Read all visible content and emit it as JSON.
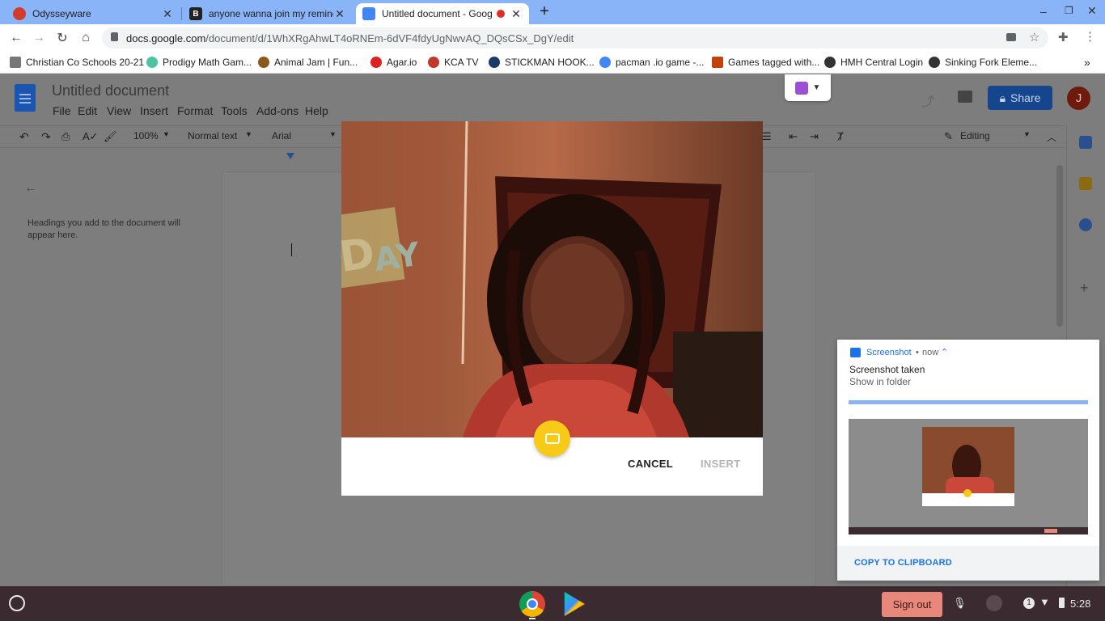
{
  "tabs": [
    {
      "title": "Odysseyware",
      "favicon_color": "#d23c2b"
    },
    {
      "title": "anyone wanna join my reminde",
      "favicon_color": "#222222"
    },
    {
      "title": "Untitled document - Google I",
      "favicon_color": "#4285f4"
    }
  ],
  "address": {
    "host": "docs.google.com",
    "path": "/document/d/1WhXRgAhwLT4oRNEm-6dVF4fdyUgNwvAQ_DQsCSx_DgY/edit"
  },
  "bookmarks": [
    {
      "label": "Christian Co Schools 20-21",
      "color": "#777777"
    },
    {
      "label": "Prodigy Math Gam...",
      "color": "#4cc4a4"
    },
    {
      "label": "Animal Jam | Fun...",
      "color": "#8b5a1a"
    },
    {
      "label": "Agar.io",
      "color": "#e02020"
    },
    {
      "label": "KCA TV",
      "color": "#c0392b"
    },
    {
      "label": "STICKMAN HOOK...",
      "color": "#1a3a6a"
    },
    {
      "label": "pacman .io game -...",
      "color": "#4285f4"
    },
    {
      "label": "Games tagged with...",
      "color": "#c2410c"
    },
    {
      "label": "HMH Central Login",
      "color": "#333333"
    },
    {
      "label": "Sinking Fork Eleme...",
      "color": "#333333"
    }
  ],
  "doc": {
    "title": "Untitled document",
    "menus": [
      "File",
      "Edit",
      "View",
      "Insert",
      "Format",
      "Tools",
      "Add-ons",
      "Help"
    ],
    "zoom": "100%",
    "style": "Normal text",
    "font": "Arial",
    "mode": "Editing",
    "share_label": "Share",
    "avatar_letter": "J",
    "outline_hint": "Headings you add to the document will appear here."
  },
  "dialog": {
    "cancel_label": "CANCEL",
    "insert_label": "INSERT"
  },
  "notification": {
    "app": "Screenshot",
    "time": "now",
    "title": "Screenshot taken",
    "subtitle": "Show in folder",
    "action": "COPY TO CLIPBOARD"
  },
  "shelf": {
    "signout_label": "Sign out",
    "time": "5:28",
    "badge": "1"
  },
  "colors": {
    "tabstrip": "#8ab4f8",
    "accent": "#1a73e8",
    "shutter": "#f7ca18",
    "signout": "#e8887a"
  }
}
